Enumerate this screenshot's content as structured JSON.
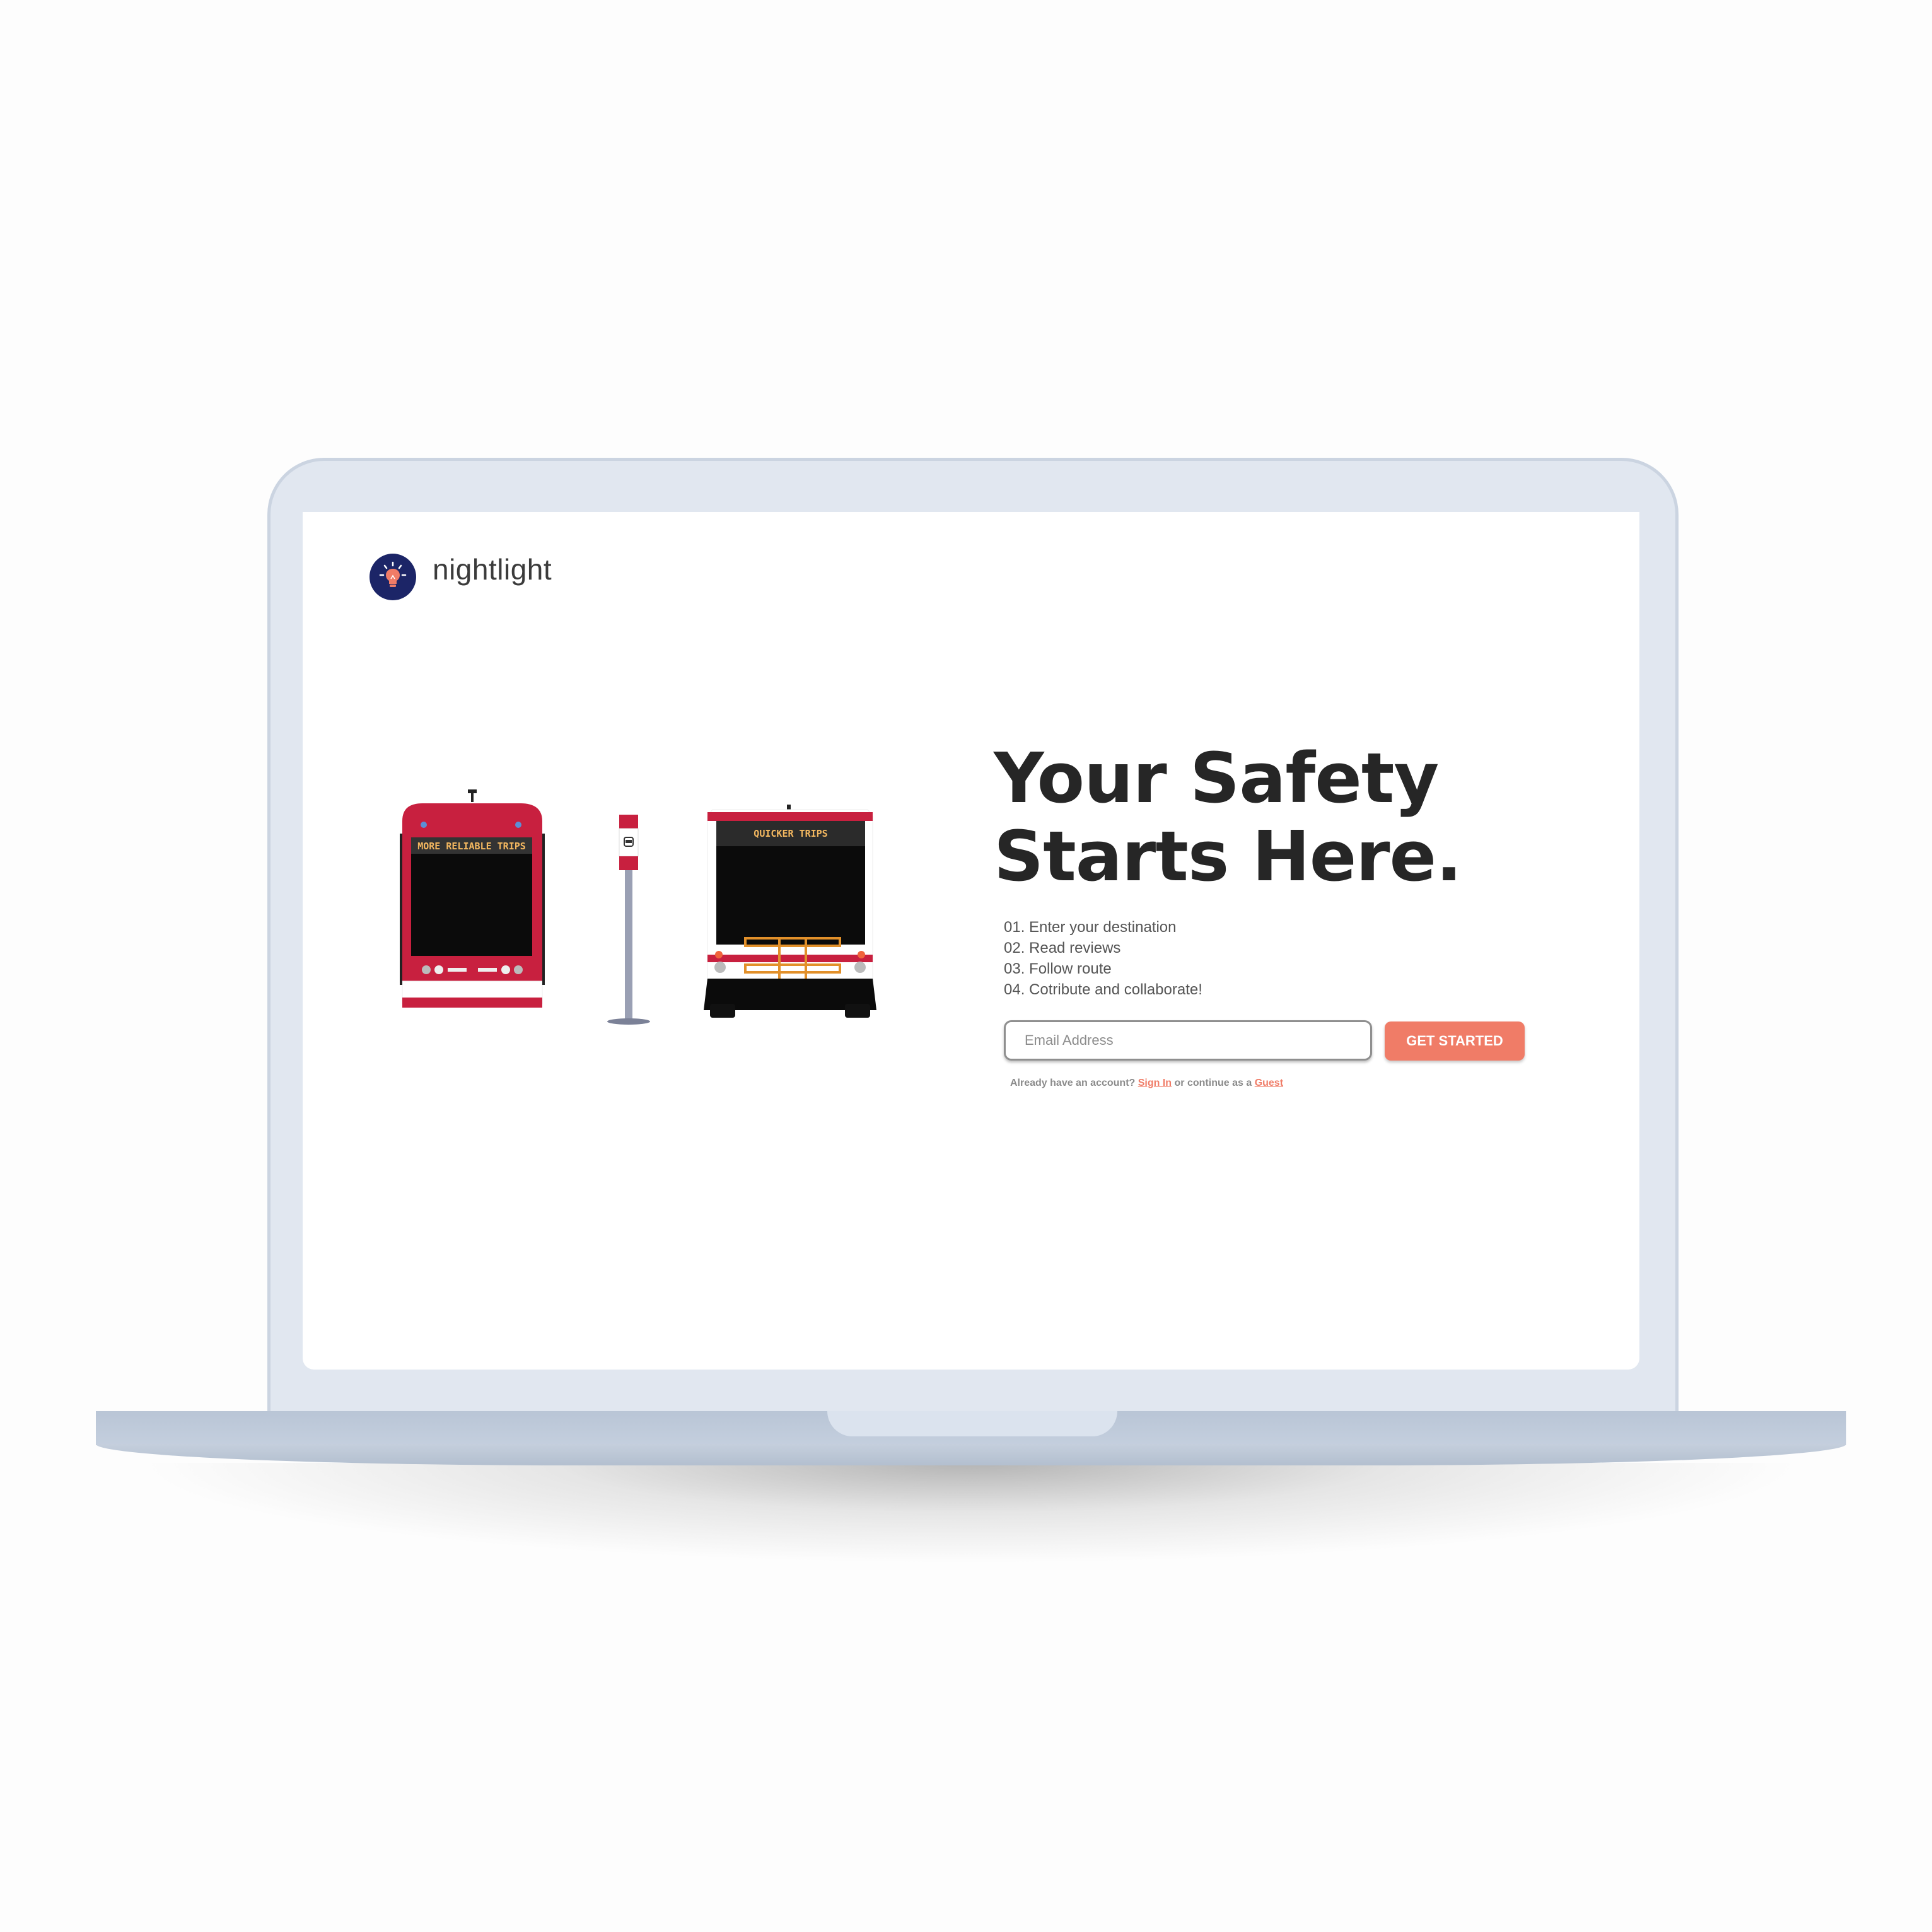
{
  "app": {
    "brand_name": "nightlight",
    "logo_icon": "lightbulb-icon",
    "logo_bg_color": "#1c2567",
    "accent_color": "#f07c67"
  },
  "hero": {
    "headline_line1": "Your Safety",
    "headline_line2": "Starts Here.",
    "steps": [
      "01. Enter your destination",
      "02. Read reviews",
      "03. Follow route",
      "04. Cotribute and collaborate!"
    ]
  },
  "signup": {
    "email_placeholder": "Email Address",
    "email_value": "",
    "cta_label": "GET STARTED"
  },
  "account": {
    "prompt": "Already have an account?",
    "sign_in_label": "Sign In",
    "middle_text": "or continue as a",
    "guest_label": "Guest"
  },
  "illustration": {
    "streetcar_sign": "MORE RELIABLE TRIPS",
    "bus_sign": "QUICKER TRIPS",
    "streetcar_color": "#c8203f",
    "bus_stop_icon": "bus-icon"
  }
}
